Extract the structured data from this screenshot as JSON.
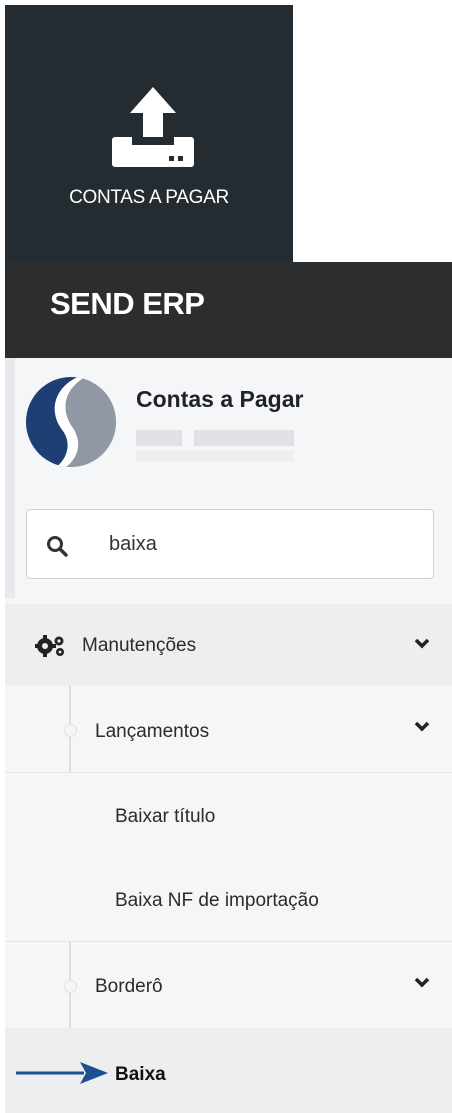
{
  "tile": {
    "label": "CONTAS A PAGAR",
    "icon": "upload-tray-icon"
  },
  "brand": {
    "title": "SEND ERP"
  },
  "module": {
    "title": "Contas a Pagar"
  },
  "search": {
    "value": "baixa",
    "icon": "search-icon"
  },
  "menu": {
    "group": {
      "label": "Manutenções",
      "icon": "gears-icon"
    },
    "lancamentos": {
      "label": "Lançamentos",
      "items": [
        {
          "label": "Baixar título"
        },
        {
          "label": "Baixa NF de importação"
        }
      ]
    },
    "bordero": {
      "label": "Borderô"
    },
    "baixa": {
      "label": "Baixa"
    }
  },
  "colors": {
    "tile_bg": "#242c31",
    "brand_bg": "#2c2d2f",
    "panel_bg": "#f5f6f8",
    "arrow": "#1f4f91"
  }
}
